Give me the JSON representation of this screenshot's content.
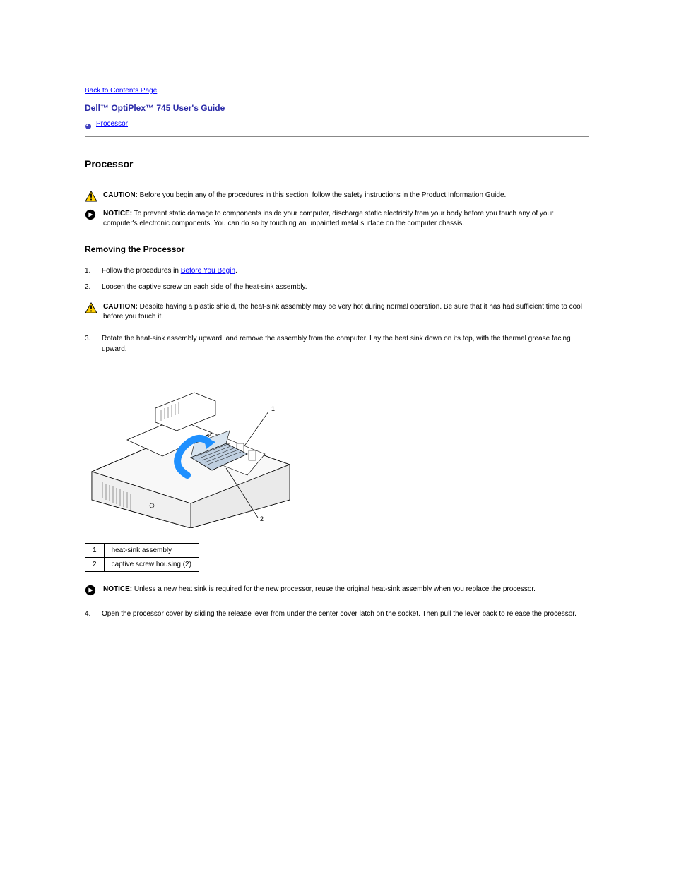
{
  "back_link": "Back to Contents Page",
  "doc_title": "Dell™ OptiPlex™ 745 User's Guide",
  "toc_link": "Processor",
  "section_heading": "Processor",
  "caution": {
    "label": "CAUTION:",
    "text": " Before you begin any of the procedures in this section, follow the safety instructions in the Product Information Guide."
  },
  "notice1": {
    "label": "NOTICE:",
    "text": " To prevent static damage to components inside your computer, discharge static electricity from your body before you touch any of your computer's electronic components. You can do so by touching an unpainted metal surface on the computer chassis."
  },
  "removing_heading": "Removing the Processor",
  "steps_a": [
    {
      "num": "1.",
      "pre": "Follow the procedures in ",
      "link": "Before You Begin",
      "post": "."
    },
    {
      "num": "2.",
      "pre": "Loosen the captive screw on each side of the heat-sink assembly.",
      "link": "",
      "post": ""
    }
  ],
  "caution2": {
    "label": "CAUTION:",
    "text": " Despite having a plastic shield, the heat-sink assembly may be very hot during normal operation. Be sure that it has had sufficient time to cool before you touch it."
  },
  "steps_b": [
    {
      "num": "3.",
      "text": "Rotate the heat-sink assembly upward, and remove the assembly from the computer. Lay the heat sink down on its top, with the thermal grease facing upward."
    }
  ],
  "legend": [
    {
      "num": "1",
      "label": "heat-sink assembly"
    },
    {
      "num": "2",
      "label": "captive screw housing (2)"
    }
  ],
  "notice2": {
    "label": "NOTICE:",
    "text": " Unless a new heat sink is required for the new processor, reuse the original heat-sink assembly when you replace the processor."
  },
  "steps_c": [
    {
      "num": "4.",
      "text": "Open the processor cover by sliding the release lever from under the center cover latch on the socket. Then pull the lever back to release the processor."
    }
  ]
}
